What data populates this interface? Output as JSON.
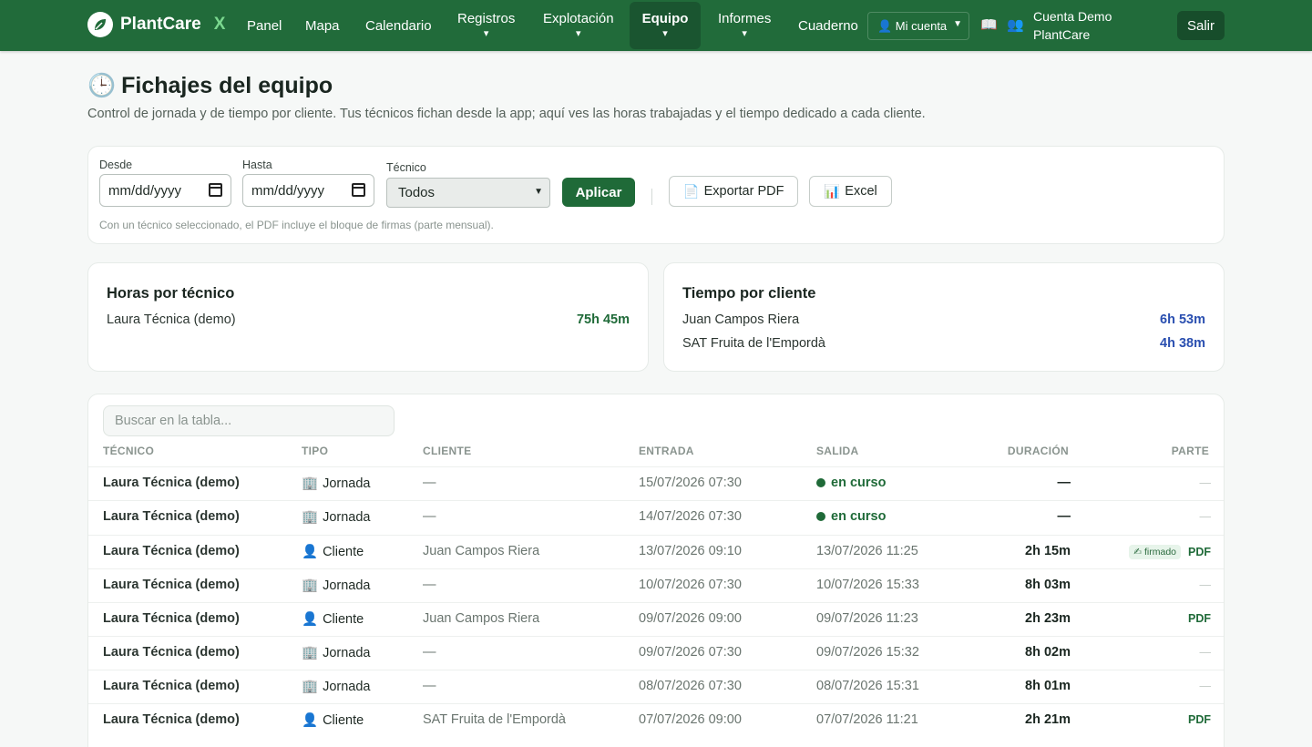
{
  "brand": {
    "name": "PlantCare",
    "suffix": "X"
  },
  "nav": {
    "panel": "Panel",
    "mapa": "Mapa",
    "calendario": "Calendario",
    "registros": "Registros",
    "explotacion": "Explotación",
    "equipo": "Equipo",
    "informes": "Informes",
    "cuaderno": "Cuaderno",
    "caret": "▾",
    "account_select": "👤 Mi cuenta",
    "book_icon": "📖",
    "team_icon": "👥",
    "account_name": "Cuenta Demo PlantCare",
    "logout": "Salir"
  },
  "header": {
    "icon": "🕒",
    "title": "Fichajes del equipo",
    "subtitle": "Control de jornada y de tiempo por cliente. Tus técnicos fichan desde la app; aquí ves las horas trabajadas y el tiempo dedicado a cada cliente."
  },
  "filters": {
    "desde_label": "Desde",
    "desde_value": "mm/dd/yyyy",
    "hasta_label": "Hasta",
    "hasta_value": "mm/dd/yyyy",
    "tecnico_label": "Técnico",
    "tecnico_value": "Todos",
    "apply": "Aplicar",
    "export_pdf": "Exportar PDF",
    "export_pdf_icon": "📄",
    "excel": "Excel",
    "excel_icon": "📊",
    "hint": "Con un técnico seleccionado, el PDF incluye el bloque de firmas (parte mensual)."
  },
  "horas_por_tecnico": {
    "title": "Horas por técnico",
    "rows": [
      {
        "name": "Laura Técnica (demo)",
        "value": "75h 45m"
      }
    ]
  },
  "tiempo_por_cliente": {
    "title": "Tiempo por cliente",
    "rows": [
      {
        "name": "Juan Campos Riera",
        "value": "6h 53m"
      },
      {
        "name": "SAT Fruita de l'Empordà",
        "value": "4h 38m"
      }
    ]
  },
  "table": {
    "search_placeholder": "Buscar en la tabla...",
    "headers": {
      "tecnico": "TÉCNICO",
      "tipo": "TIPO",
      "cliente": "CLIENTE",
      "entrada": "ENTRADA",
      "salida": "SALIDA",
      "duracion": "DURACIÓN",
      "parte": "PARTE"
    },
    "icons": {
      "jornada": "🏢",
      "cliente": "👤"
    },
    "rows": [
      {
        "tecnico": "Laura Técnica (demo)",
        "tipo": "Jornada",
        "tipo_icon": "🏢",
        "cliente": "—",
        "entrada": "15/07/2026 07:30",
        "salida": "en curso",
        "live": true,
        "duracion": "—",
        "parte": "—",
        "signed": ""
      },
      {
        "tecnico": "Laura Técnica (demo)",
        "tipo": "Jornada",
        "tipo_icon": "🏢",
        "cliente": "—",
        "entrada": "14/07/2026 07:30",
        "salida": "en curso",
        "live": true,
        "duracion": "—",
        "parte": "—",
        "signed": ""
      },
      {
        "tecnico": "Laura Técnica (demo)",
        "tipo": "Cliente",
        "tipo_icon": "👤",
        "cliente": "Juan Campos Riera",
        "entrada": "13/07/2026 09:10",
        "salida": "13/07/2026 11:25",
        "live": false,
        "duracion": "2h 15m",
        "parte": "PDF",
        "signed": "✍ firmado"
      },
      {
        "tecnico": "Laura Técnica (demo)",
        "tipo": "Jornada",
        "tipo_icon": "🏢",
        "cliente": "—",
        "entrada": "10/07/2026 07:30",
        "salida": "10/07/2026 15:33",
        "live": false,
        "duracion": "8h 03m",
        "parte": "—",
        "signed": ""
      },
      {
        "tecnico": "Laura Técnica (demo)",
        "tipo": "Cliente",
        "tipo_icon": "👤",
        "cliente": "Juan Campos Riera",
        "entrada": "09/07/2026 09:00",
        "salida": "09/07/2026 11:23",
        "live": false,
        "duracion": "2h 23m",
        "parte": "PDF",
        "signed": ""
      },
      {
        "tecnico": "Laura Técnica (demo)",
        "tipo": "Jornada",
        "tipo_icon": "🏢",
        "cliente": "—",
        "entrada": "09/07/2026 07:30",
        "salida": "09/07/2026 15:32",
        "live": false,
        "duracion": "8h 02m",
        "parte": "—",
        "signed": ""
      },
      {
        "tecnico": "Laura Técnica (demo)",
        "tipo": "Jornada",
        "tipo_icon": "🏢",
        "cliente": "—",
        "entrada": "08/07/2026 07:30",
        "salida": "08/07/2026 15:31",
        "live": false,
        "duracion": "8h 01m",
        "parte": "—",
        "signed": ""
      },
      {
        "tecnico": "Laura Técnica (demo)",
        "tipo": "Cliente",
        "tipo_icon": "👤",
        "cliente": "SAT Fruita de l'Empordà",
        "entrada": "07/07/2026 09:00",
        "salida": "07/07/2026 11:21",
        "live": false,
        "duracion": "2h 21m",
        "parte": "PDF",
        "signed": ""
      }
    ]
  }
}
